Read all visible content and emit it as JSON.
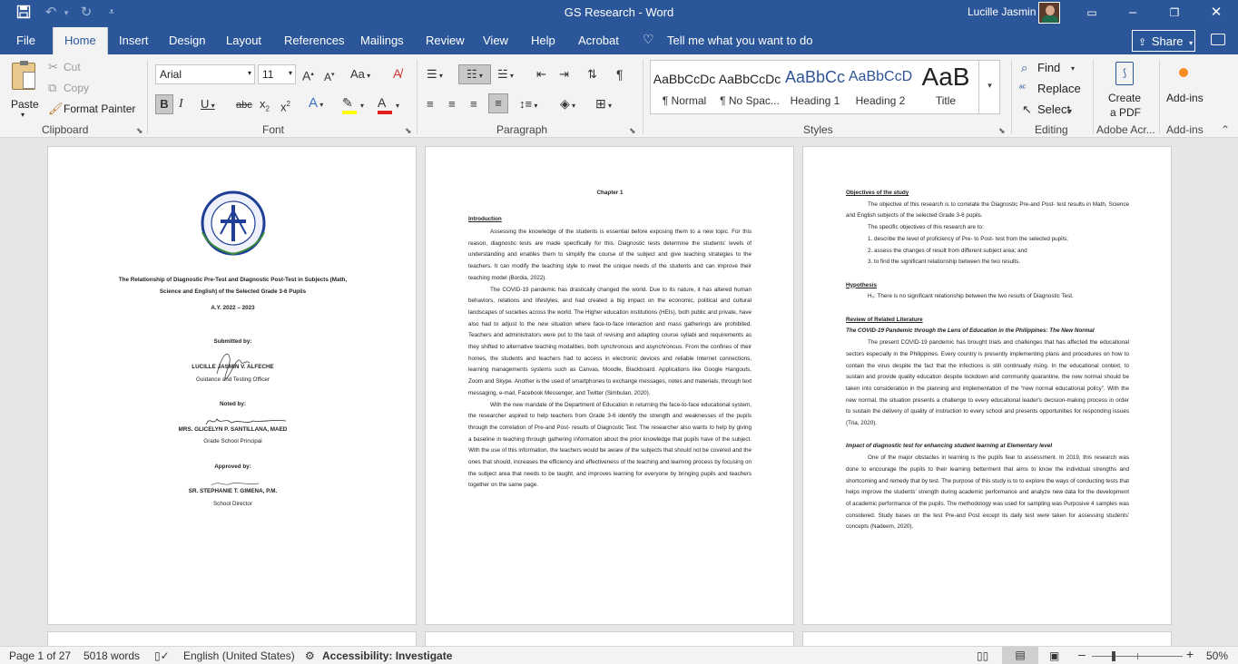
{
  "window": {
    "title": "GS Research  -  Word",
    "user": "Lucille Jasmin"
  },
  "tabs": [
    {
      "label": "File"
    },
    {
      "label": "Home"
    },
    {
      "label": "Insert"
    },
    {
      "label": "Design"
    },
    {
      "label": "Layout"
    },
    {
      "label": "References"
    },
    {
      "label": "Mailings"
    },
    {
      "label": "Review"
    },
    {
      "label": "View"
    },
    {
      "label": "Help"
    },
    {
      "label": "Acrobat"
    }
  ],
  "tellme": "Tell me what you want to do",
  "share": "Share",
  "ribbon": {
    "clipboard": {
      "paste": "Paste",
      "cut": "Cut",
      "copy": "Copy",
      "format_painter": "Format Painter",
      "label": "Clipboard"
    },
    "font": {
      "name": "Arial",
      "size": "11",
      "label": "Font"
    },
    "paragraph": {
      "label": "Paragraph"
    },
    "styles": {
      "label": "Styles",
      "items": [
        {
          "preview": "AaBbCcDc",
          "name": "¶ Normal"
        },
        {
          "preview": "AaBbCcDc",
          "name": "¶ No Spac..."
        },
        {
          "preview": "AaBbCc",
          "name": "Heading 1"
        },
        {
          "preview": "AaBbCcD",
          "name": "Heading 2"
        },
        {
          "preview": "AaB",
          "name": "Title"
        }
      ]
    },
    "editing": {
      "find": "Find",
      "replace": "Replace",
      "select": "Select",
      "label": "Editing"
    },
    "adobe": {
      "create1": "Create",
      "create2": "a PDF",
      "label": "Adobe Acr..."
    },
    "addins": {
      "btn": "Add-ins",
      "label": "Add-ins"
    }
  },
  "colors": {
    "word_blue": "#2b579a",
    "heading_blue": "#2f5496",
    "fontcolor_red": "#e02020",
    "highlight_yellow": "#ffff00"
  },
  "page1": {
    "title1": "The Relationship of Diagnostic Pre-Test and Diagnostic Post-Test in Subjects (Math,",
    "title2": "Science and English) of the Selected Grade 3-6 Pupils",
    "year": "A.Y. 2022 – 2023",
    "submitted_label": "Submitted by:",
    "submitted_name": "LUCILLE JASMIN V. ALFECHE",
    "submitted_role": "Guidance and Testing Officer",
    "noted_label": "Noted by:",
    "noted_name": "MRS. GLICELYN P. SANTILLANA, MAED",
    "noted_role": "Grade School Principal",
    "approved_label": "Approved by:",
    "approved_name": "SR. STEPHANIE T. GIMENA, P.M.",
    "approved_role": "School Director"
  },
  "page2": {
    "chapter": "Chapter 1",
    "intro_heading": "Introduction",
    "p1": "Assessing the knowledge of the students is essential before exposing them to a new topic. For this reason, diagnostic tests are made specifically for this. Diagnostic tests determine the students' levels of understanding and enables them to simplify the course of the subject and give teaching strategies to the teachers. It can modify the teaching style to meet the unique needs of the students and can improve their teaching model (Bordia, 2022).",
    "p2": "The COVID-19 pandemic has drastically changed the world. Due to its nature, it has altered human behaviors, relations and lifestyles, and had created a big impact on the economic, political and cultural landscapes of societies across the world. The Higher education institutions (HEIs), both public and private, have also had to adjust to the new situation where face-to-face interaction and mass gatherings are prohibited. Teachers and administrators were put to the task of revising and adapting course syllabi and requirements as they shifted to alternative teaching modalities, both synchronous and asynchronous. From the confines of their homes, the students and teachers had to access in electronic devices and reliable Internet connections, learning managements systems such as Canvas, Moodle, Blackboard. Applications like Google Hangouts, Zoom and Skype. Another is the used of smartphones to exchange messages, notes and materials, through text messaging, e-mail, Facebook Messenger, and Twitter (Simbulan, 2020).",
    "p3": "With the new mandate of the Department of Education in returning the face-to-face educational system, the researcher aspired to help teachers from Grade 3-6 identify the strength and weaknesses of the pupils through the correlation of Pre-and Post- results of Diagnostic Test. The researcher also wants to help by giving a baseline in teaching through gathering information about the prior knowledge that pupils have of the subject. With the use of this information, the teachers would be aware of the subjects that should not be covered and the ones that should, increases the efficiency and effectiveness of the teaching and learning process by focusing on the subject area that needs to be taught, and improves learning for everyone by bringing pupils and teachers together on the same page."
  },
  "page3": {
    "obj_heading": "Objectives of the study",
    "obj_p1": "The objective of this research is to correlate the Diagnostic Pre-and Post- test results in Math, Science and English subjects of the selected Grade 3-6 pupils.",
    "obj_p2": "The specific objectives of this research are to:",
    "obj_list": [
      "1.   describe the level of proficiency of Pre- to Post- test from the selected pupils;",
      "2.   assess the changes of result from different subject area; and",
      "3.   to find the significant relationship between the two results."
    ],
    "hyp_heading": "Hypothesis",
    "hyp_text": "H₀: There is no significant relationship between the two results of Diagnostic Test.",
    "rrl_heading": "Review of Related Literature",
    "rrl_sub": "The COVID-19 Pandemic through the Lens of Education in the Philippines: The New Normal",
    "rrl_p1": "The present COVID-19 pandemic has brought trials and challenges that has affected the educational sectors especially in the Philippines. Every country is presently implementing plans and procedures on how to contain the virus despite the fact that the infections is still continually rising. In the educational context, to sustain and provide quality education despite lockdown and community quarantine, the new normal should be taken into consideration in the planning and implementation of the “new normal educational policy”. With the new normal, the situation presents a challenge to every educational leader's decision-making process in order to sustain the delivery of quality of instruction to every school and presents opportunities for responding issues (Tria, 2020).",
    "impact_heading": "Impact of diagnostic test for enhancing student learning at Elementary level",
    "impact_p": "One of the major obstacles in learning is the pupils fear to assessment. In 2019, this research was done to encourage the pupils to their learning betterment that aims to know the individual strengths and shortcoming and remedy that by test. The purpose of this study is to to explore the ways of conducting tests that helps improve the students' strength during academic performance and analyze new data for the development of academic performance of the pupils. The methodology was used for sampling was Purposive 4 samples was considered. Study bases on the test Pre-and Post except its daily test were taken for assessing students' concepts (Nadeem, 2020)."
  },
  "status": {
    "page": "Page 1 of 27",
    "words": "5018 words",
    "language": "English (United States)",
    "accessibility": "Accessibility: Investigate",
    "zoom": "50%",
    "zoom_fraction": 0.5
  }
}
